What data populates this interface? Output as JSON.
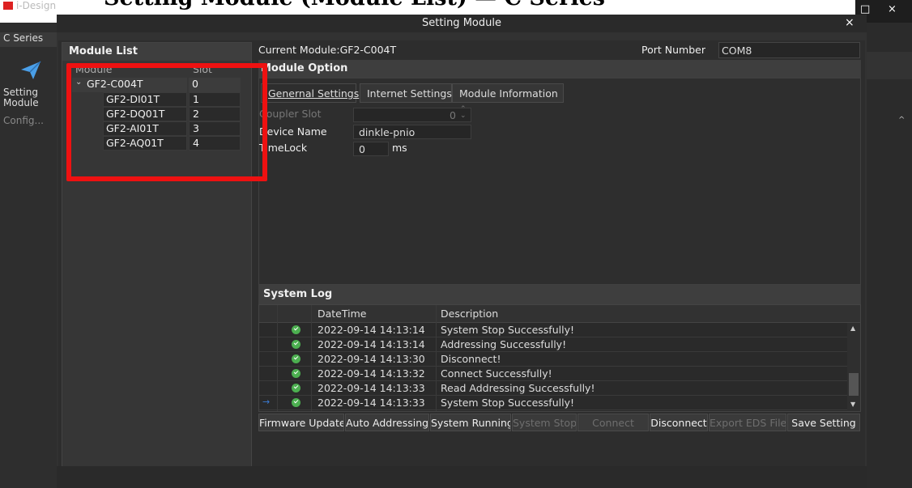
{
  "caption": {
    "text": "Setting Module (Module List) — C Series"
  },
  "app": {
    "name": "i-Design",
    "min_glyph": "□",
    "close_glyph": "×"
  },
  "sidebar": {
    "series_label": "C Series",
    "setting_label": "Setting Module",
    "config_label": "Config..."
  },
  "dialog": {
    "title": "Setting Module",
    "close_glyph": "×"
  },
  "module_list": {
    "title": "Module List",
    "col_module": "Module",
    "col_slot": "Slot",
    "rows": [
      {
        "name": "GF2-C004T",
        "slot": "0",
        "expanded": true
      },
      {
        "name": "GF2-DI01T",
        "slot": "1"
      },
      {
        "name": "GF2-DQ01T",
        "slot": "2"
      },
      {
        "name": "GF2-AI01T",
        "slot": "3"
      },
      {
        "name": "GF2-AQ01T",
        "slot": "4"
      }
    ],
    "highlight_color": "#ee1111"
  },
  "current": {
    "module_label": "Current Module:GF2-C004T",
    "port_label": "Port Number",
    "port_value": "COM8"
  },
  "module_option": {
    "title": "Module Option",
    "tabs": [
      "Genernal Settings",
      "Internet Settings",
      "Module Information"
    ],
    "active_tab": 0,
    "coupler_slot_label": "Coupler Slot",
    "coupler_slot_value": "0",
    "device_name_label": "Device Name",
    "device_name_value": "dinkle-pnio",
    "timelock_label": "TimeLock",
    "timelock_value": "0",
    "timelock_unit": "ms"
  },
  "system_log": {
    "title": "System Log",
    "col_datetime": "DateTime",
    "col_description": "Description",
    "rows": [
      {
        "datetime": "2022-09-14 14:13:14",
        "description": "System Stop Successfully!"
      },
      {
        "datetime": "2022-09-14 14:13:14",
        "description": "Addressing Successfully!"
      },
      {
        "datetime": "2022-09-14 14:13:30",
        "description": "Disconnect!"
      },
      {
        "datetime": "2022-09-14 14:13:32",
        "description": "Connect Successfully!"
      },
      {
        "datetime": "2022-09-14 14:13:33",
        "description": "Read Addressing Successfully!"
      },
      {
        "datetime": "2022-09-14 14:13:33",
        "description": "System Stop Successfully!",
        "current": true
      }
    ]
  },
  "buttons": {
    "firmware_update": "Firmware Update",
    "auto_addressing": "Auto Addressing",
    "system_running": "System Running",
    "system_stop": "System Stop",
    "connect": "Connect",
    "disconnect": "Disconnect",
    "export_eds": "Export EDS File",
    "save_setting": "Save Setting"
  },
  "colors": {
    "accent": "#3a7bd5",
    "ok": "#4caf50",
    "panel": "#323232"
  }
}
